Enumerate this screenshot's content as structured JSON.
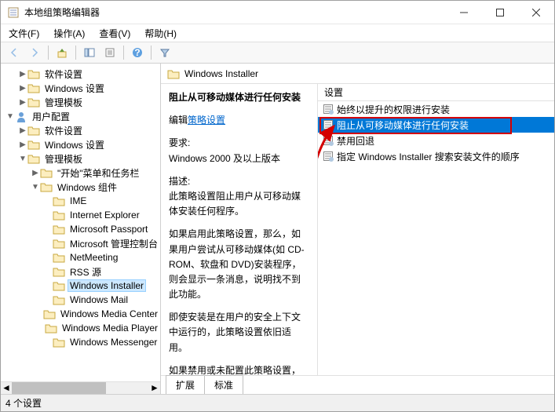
{
  "window": {
    "title": "本地组策略编辑器"
  },
  "menu": {
    "file": "文件(F)",
    "action": "操作(A)",
    "view": "查看(V)",
    "help": "帮助(H)"
  },
  "tree": {
    "items": [
      {
        "indent": 1,
        "expand": "▶",
        "type": "folder",
        "label": "软件设置"
      },
      {
        "indent": 1,
        "expand": "▶",
        "type": "folder",
        "label": "Windows 设置"
      },
      {
        "indent": 1,
        "expand": "▶",
        "type": "folder",
        "label": "管理模板"
      },
      {
        "indent": 0,
        "expand": "▼",
        "type": "user",
        "label": "用户配置"
      },
      {
        "indent": 1,
        "expand": "▶",
        "type": "folder",
        "label": "软件设置"
      },
      {
        "indent": 1,
        "expand": "▶",
        "type": "folder",
        "label": "Windows 设置"
      },
      {
        "indent": 1,
        "expand": "▼",
        "type": "folder",
        "label": "管理模板"
      },
      {
        "indent": 2,
        "expand": "▶",
        "type": "folder",
        "label": "\"开始\"菜单和任务栏"
      },
      {
        "indent": 2,
        "expand": "▼",
        "type": "folder",
        "label": "Windows 组件"
      },
      {
        "indent": 3,
        "expand": "",
        "type": "folder",
        "label": "IME"
      },
      {
        "indent": 3,
        "expand": "",
        "type": "folder",
        "label": "Internet Explorer"
      },
      {
        "indent": 3,
        "expand": "",
        "type": "folder",
        "label": "Microsoft Passport"
      },
      {
        "indent": 3,
        "expand": "",
        "type": "folder",
        "label": "Microsoft 管理控制台"
      },
      {
        "indent": 3,
        "expand": "",
        "type": "folder",
        "label": "NetMeeting"
      },
      {
        "indent": 3,
        "expand": "",
        "type": "folder",
        "label": "RSS 源"
      },
      {
        "indent": 3,
        "expand": "",
        "type": "folder",
        "label": "Windows Installer",
        "selected": true
      },
      {
        "indent": 3,
        "expand": "",
        "type": "folder",
        "label": "Windows Mail"
      },
      {
        "indent": 3,
        "expand": "",
        "type": "folder",
        "label": "Windows Media Center"
      },
      {
        "indent": 3,
        "expand": "",
        "type": "folder",
        "label": "Windows Media Player"
      },
      {
        "indent": 3,
        "expand": "",
        "type": "folder",
        "label": "Windows Messenger"
      }
    ]
  },
  "right": {
    "header": "Windows Installer",
    "desc": {
      "title": "阻止从可移动媒体进行任何安装",
      "edit_prefix": "编辑",
      "edit_link": "策略设置",
      "req_label": "要求:",
      "req_text": "Windows 2000 及以上版本",
      "desc_label": "描述:",
      "desc_p1": "此策略设置阻止用户从可移动媒体安装任何程序。",
      "desc_p2": "如果启用此策略设置，那么，如果用户尝试从可移动媒体(如 CD-ROM、软盘和 DVD)安装程序，则会显示一条消息，说明找不到此功能。",
      "desc_p3": "即使安装是在用户的安全上下文中运行的，此策略设置依旧适用。",
      "desc_p4": "如果禁用或未配置此策略设置，那"
    },
    "list_header": "设置",
    "list": [
      {
        "label": "始终以提升的权限进行安装"
      },
      {
        "label": "阻止从可移动媒体进行任何安装",
        "selected": true
      },
      {
        "label": "禁用回退"
      },
      {
        "label": "指定 Windows Installer 搜索安装文件的顺序"
      }
    ]
  },
  "tabs": {
    "extended": "扩展",
    "standard": "标准"
  },
  "status": "4 个设置"
}
